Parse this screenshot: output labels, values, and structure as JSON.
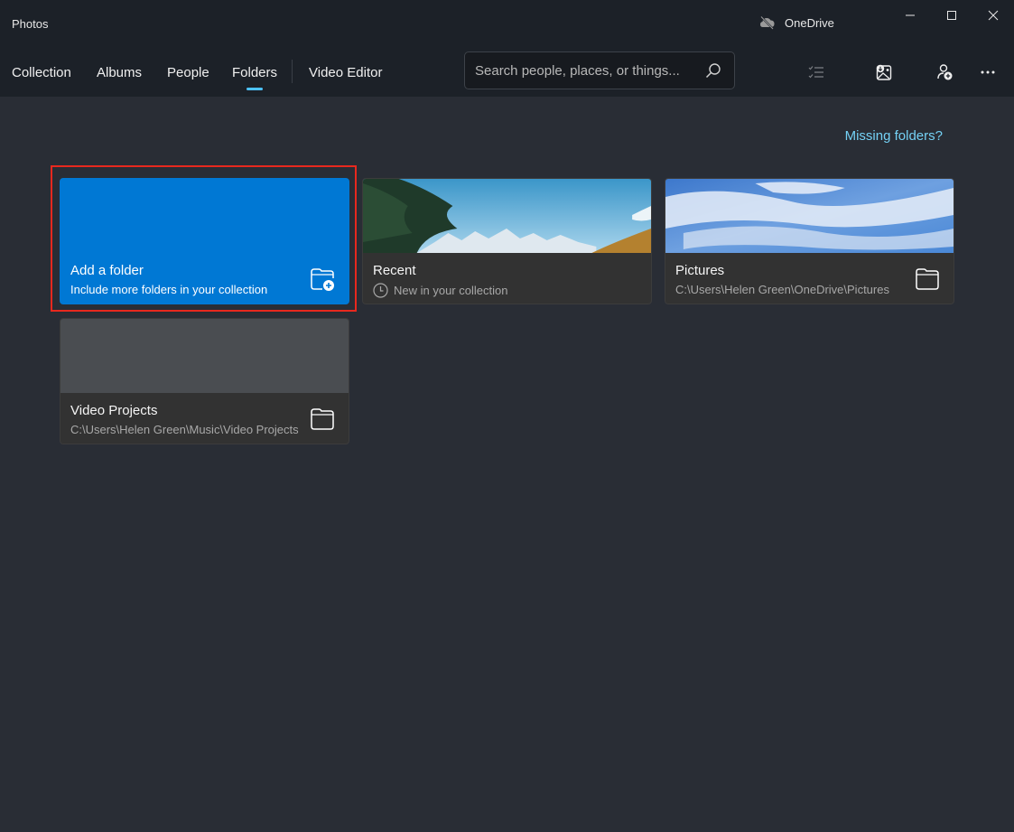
{
  "window": {
    "title": "Photos",
    "onedrive_label": "OneDrive",
    "controls": [
      "minimize",
      "maximize",
      "close"
    ]
  },
  "nav": {
    "tabs": [
      {
        "label": "Collection",
        "active": false
      },
      {
        "label": "Albums",
        "active": false
      },
      {
        "label": "People",
        "active": false
      },
      {
        "label": "Folders",
        "active": true
      },
      {
        "label": "Video Editor",
        "active": false
      }
    ]
  },
  "search": {
    "placeholder": "Search people, places, or things...",
    "value": ""
  },
  "toolbar": {
    "icons": [
      "select-checklist-icon",
      "import-image-icon",
      "add-person-icon",
      "more-options-icon"
    ]
  },
  "main": {
    "missing_folders_link": "Missing folders?",
    "folders": [
      {
        "title": "Add a folder",
        "subtitle": "Include more folders in your collection",
        "icon": "folder-add-icon",
        "highlighted": true
      },
      {
        "title": "Recent",
        "subtitle": "New in your collection",
        "icon": "clock-icon"
      },
      {
        "title": "Pictures",
        "subtitle": "C:\\Users\\Helen Green\\OneDrive\\Pictures",
        "icon": "folder-icon"
      },
      {
        "title": "Video Projects",
        "subtitle": "C:\\Users\\Helen Green\\Music\\Video Projects",
        "icon": "folder-icon"
      }
    ]
  },
  "colors": {
    "accent": "#0078d4",
    "active_indicator": "#4cc2ff",
    "link": "#74d1f5",
    "highlight_border": "#e8281e",
    "titlebar_bg": "#1c2128",
    "content_bg": "#292d35"
  }
}
